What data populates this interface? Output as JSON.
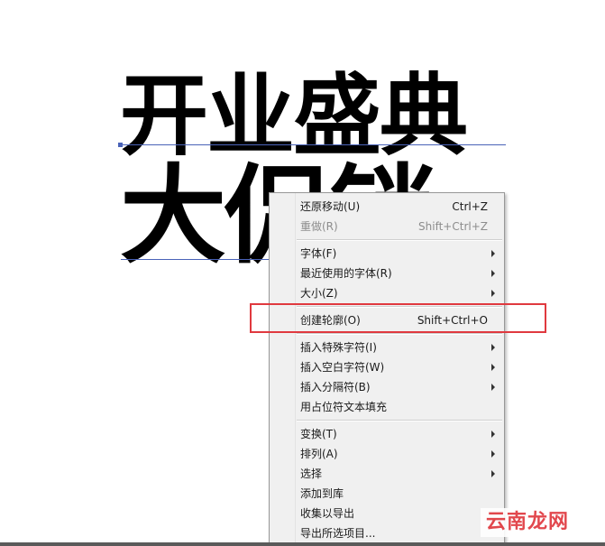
{
  "canvas": {
    "line1": "开业盛典",
    "line2": "大促销"
  },
  "menu": {
    "undo": {
      "label": "还原移动(U)",
      "shortcut": "Ctrl+Z"
    },
    "redo": {
      "label": "重做(R)",
      "shortcut": "Shift+Ctrl+Z"
    },
    "font": {
      "label": "字体(F)"
    },
    "recent_fonts": {
      "label": "最近使用的字体(R)"
    },
    "size": {
      "label": "大小(Z)"
    },
    "create_outlines": {
      "label": "创建轮廓(O)",
      "shortcut": "Shift+Ctrl+O"
    },
    "insert_special": {
      "label": "插入特殊字符(I)"
    },
    "insert_whitespace": {
      "label": "插入空白字符(W)"
    },
    "insert_break": {
      "label": "插入分隔符(B)"
    },
    "fill_placeholder": {
      "label": "用占位符文本填充"
    },
    "transform": {
      "label": "变换(T)"
    },
    "arrange": {
      "label": "排列(A)"
    },
    "select": {
      "label": "选择"
    },
    "add_to_library": {
      "label": "添加到库"
    },
    "collect_export": {
      "label": "收集以导出"
    },
    "export_selection": {
      "label": "导出所选项目..."
    }
  },
  "watermark": {
    "text": "云南龙网"
  },
  "colors": {
    "highlight": "#e0393f",
    "baseline": "#4a63b8"
  }
}
